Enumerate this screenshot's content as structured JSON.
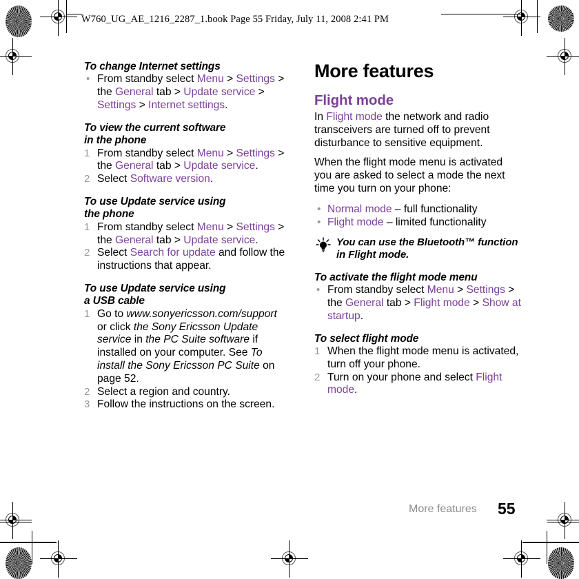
{
  "header": {
    "text": "W760_UG_AE_1216_2287_1.book  Page 55  Friday, July 11, 2008  2:41 PM"
  },
  "colors": {
    "ui_purple": "#7B3F99",
    "marker_gray": "#9a9a9a",
    "footer_gray": "#8c8c8c",
    "text_black": "#000000"
  },
  "left_column": {
    "proc1": {
      "heading": "To change Internet settings",
      "bullet": "•",
      "step_parts": {
        "p1": "From standby select ",
        "ui1": "Menu",
        "p2": " > ",
        "ui2": "Settings",
        "p3": " > the ",
        "ui3": "General",
        "p4": " tab > ",
        "ui4": "Update service",
        "p5": " > ",
        "ui5": "Settings",
        "p6": " > ",
        "ui6": "Internet settings",
        "p7": "."
      }
    },
    "proc2": {
      "heading_line1": "To view the current software",
      "heading_line2": "in the phone",
      "steps": [
        {
          "num": "1",
          "parts": {
            "p1": "From standby select ",
            "ui1": "Menu",
            "p2": " > ",
            "ui2": "Settings",
            "p3": " > the ",
            "ui3": "General",
            "p4": " tab > ",
            "ui4": "Update service",
            "p5": "."
          }
        },
        {
          "num": "2",
          "parts": {
            "p1": "Select ",
            "ui1": "Software version",
            "p2": "."
          }
        }
      ]
    },
    "proc3": {
      "heading_line1": "To use Update service using",
      "heading_line2": "the phone",
      "steps": [
        {
          "num": "1",
          "parts": {
            "p1": "From standby select ",
            "ui1": "Menu",
            "p2": " > ",
            "ui2": "Settings",
            "p3": " > the ",
            "ui3": "General",
            "p4": " tab > ",
            "ui4": "Update service",
            "p5": "."
          }
        },
        {
          "num": "2",
          "parts": {
            "p1": "Select ",
            "ui1": "Search for update",
            "p2": " and follow the instructions that appear."
          }
        }
      ]
    },
    "proc4": {
      "heading_line1": "To use Update service using",
      "heading_line2": "a USB cable",
      "steps": [
        {
          "num": "1",
          "parts": {
            "p1": "Go to ",
            "it1": "www.sonyericsson.com/support",
            "p2": " or click ",
            "it2": "the Sony Ericsson Update service",
            "p3": " in ",
            "it3": "the PC Suite software",
            "p4": " if installed on your computer. See ",
            "it4": "To install the Sony Ericsson PC Suite",
            "p5": " on page 52."
          }
        },
        {
          "num": "2",
          "parts": {
            "p1": "Select a region and country."
          }
        },
        {
          "num": "3",
          "parts": {
            "p1": "Follow the instructions on the screen."
          }
        }
      ]
    }
  },
  "right_column": {
    "chapter_title": "More features",
    "section_title": "Flight mode",
    "intro": {
      "p1": "In ",
      "ui1": "Flight mode",
      "p2": " the network and radio transceivers are turned off to prevent disturbance to sensitive equipment."
    },
    "para2": "When the flight mode menu is activated you are asked to select a mode the next time you turn on your phone:",
    "mode_bullets": [
      {
        "bullet": "•",
        "ui": "Normal mode",
        "rest": " – full functionality"
      },
      {
        "bullet": "•",
        "ui": "Flight mode",
        "rest": " – limited functionality"
      }
    ],
    "tip": {
      "icon": "lightbulb-icon",
      "line1": "You can use the Bluetooth™ function",
      "line2": "in Flight mode."
    },
    "proc5": {
      "heading": "To activate the flight mode menu",
      "bullet": "•",
      "step_parts": {
        "p1": "From standby select ",
        "ui1": "Menu",
        "p2": " > ",
        "ui2": "Settings",
        "p3": " > the ",
        "ui3": "General",
        "p4": " tab > ",
        "ui4": "Flight mode",
        "p5": " > ",
        "ui5": "Show at startup",
        "p6": "."
      }
    },
    "proc6": {
      "heading": "To select flight mode",
      "steps": [
        {
          "num": "1",
          "parts": {
            "p1": "When the flight mode menu is activated, turn off your phone."
          }
        },
        {
          "num": "2",
          "parts": {
            "p1": "Turn on your phone and select ",
            "ui1": "Flight mode",
            "p2": "."
          }
        }
      ]
    }
  },
  "footer": {
    "chapter": "More features",
    "page_number": "55"
  }
}
